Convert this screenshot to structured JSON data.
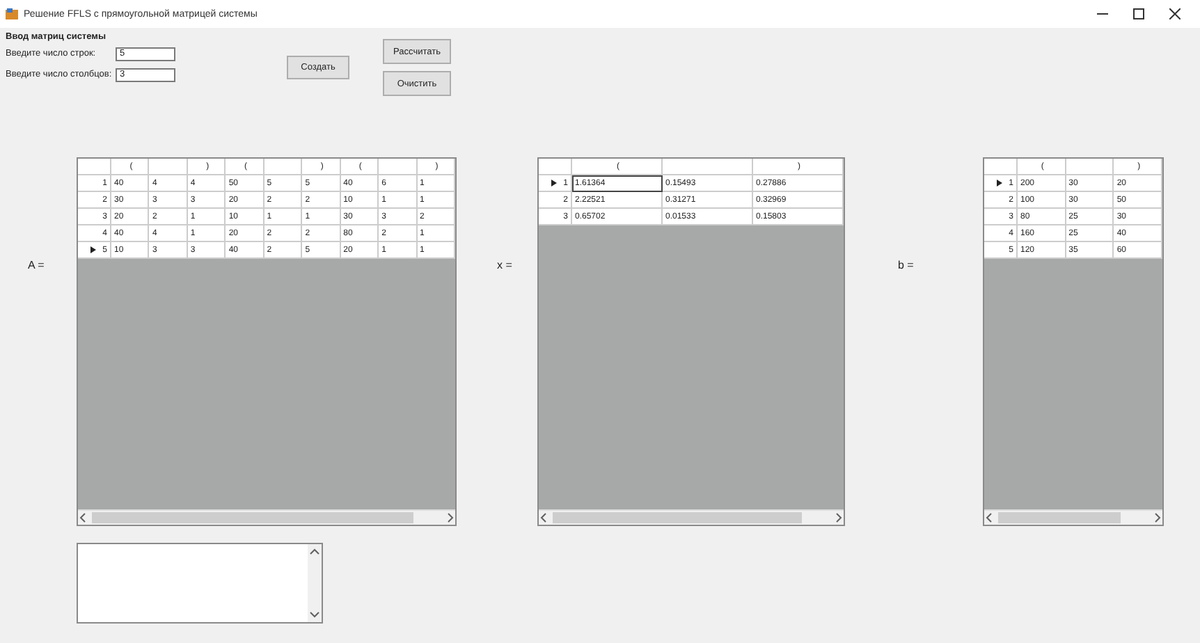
{
  "window": {
    "title": "Решение FFLS с прямоугольной матрицей системы"
  },
  "input_group": {
    "title": "Ввод матриц системы",
    "fields": [
      {
        "label": "Введите число строк:",
        "value": "5"
      },
      {
        "label": "Введите число столбцов:",
        "value": "3"
      }
    ],
    "create_button": "Создать",
    "buttons": [
      "Рассчитать",
      "Очистить"
    ]
  },
  "grids": [
    {
      "label": "A =",
      "columns": [
        {
          "label": "("
        },
        {},
        {
          "label": ")"
        },
        {
          "label": "("
        },
        {},
        {
          "label": ")"
        },
        {
          "label": "("
        },
        {},
        {
          "label": ")"
        }
      ],
      "rows": [
        {
          "header": "1",
          "selected": false,
          "cells": [
            "40",
            "4",
            "4",
            "50",
            "5",
            "5",
            "40",
            "6",
            "1"
          ]
        },
        {
          "header": "2",
          "selected": false,
          "cells": [
            "30",
            "3",
            "3",
            "20",
            "2",
            "2",
            "10",
            "1",
            "1"
          ]
        },
        {
          "header": "3",
          "selected": false,
          "cells": [
            "20",
            "2",
            "1",
            "10",
            "1",
            "1",
            "30",
            "3",
            "2"
          ]
        },
        {
          "header": "4",
          "selected": false,
          "cells": [
            "40",
            "4",
            "1",
            "20",
            "2",
            "2",
            "80",
            "2",
            "1"
          ]
        },
        {
          "header": "5",
          "selected": true,
          "cells": [
            "10",
            "3",
            "3",
            "40",
            "2",
            "5",
            "20",
            "1",
            "1"
          ]
        }
      ]
    },
    {
      "label": "x =",
      "columns": [
        {
          "label": "("
        },
        {},
        {
          "label": ")"
        }
      ],
      "rows": [
        {
          "header": "1",
          "selected": true,
          "cells": [
            {
              "value": "1.61364",
              "focused": true
            },
            {
              "value": "0.15493",
              "focused": false
            },
            {
              "value": "0.27886",
              "focused": false
            }
          ]
        },
        {
          "header": "2",
          "selected": false,
          "cells": [
            {
              "value": "2.22521",
              "focused": false
            },
            {
              "value": "0.31271",
              "focused": false
            },
            {
              "value": "0.32969",
              "focused": false
            }
          ]
        },
        {
          "header": "3",
          "selected": false,
          "cells": [
            {
              "value": "0.65702",
              "focused": false
            },
            {
              "value": "0.01533",
              "focused": false
            },
            {
              "value": "0.15803",
              "focused": false
            }
          ]
        }
      ]
    },
    {
      "label": "b =",
      "columns": [
        {
          "label": "("
        },
        {},
        {
          "label": ")"
        }
      ],
      "rows": [
        {
          "header": "1",
          "selected": true,
          "cells": [
            "200",
            "30",
            "20"
          ]
        },
        {
          "header": "2",
          "selected": false,
          "cells": [
            "100",
            "30",
            "50"
          ]
        },
        {
          "header": "3",
          "selected": false,
          "cells": [
            "80",
            "25",
            "30"
          ]
        },
        {
          "header": "4",
          "selected": false,
          "cells": [
            "160",
            "25",
            "40"
          ]
        },
        {
          "header": "5",
          "selected": false,
          "cells": [
            "120",
            "35",
            "60"
          ]
        }
      ]
    }
  ]
}
